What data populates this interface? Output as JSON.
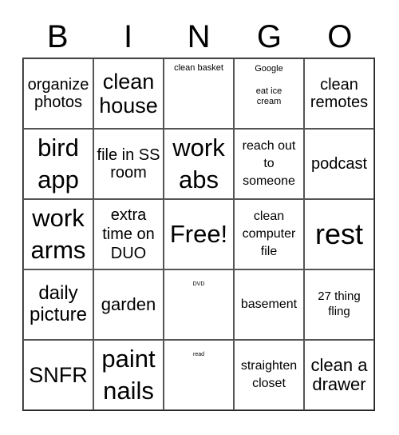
{
  "header": {
    "letters": [
      "B",
      "I",
      "N",
      "G",
      "O"
    ]
  },
  "board": {
    "rows": [
      [
        "organize photos",
        "clean house",
        "clean basket",
        "Google\n\neat ice\ncream",
        "clean remotes"
      ],
      [
        "bird app",
        "file in SS room",
        "work abs",
        "reach out to someone",
        "podcast"
      ],
      [
        "work arms",
        "extra time on DUO",
        "Free!",
        "clean computer file",
        "rest"
      ],
      [
        "daily picture",
        "garden",
        "DVD",
        "basement",
        "27 thing fling"
      ],
      [
        "SNFR",
        "paint nails",
        "read",
        "straighten closet",
        "clean a drawer"
      ]
    ]
  }
}
